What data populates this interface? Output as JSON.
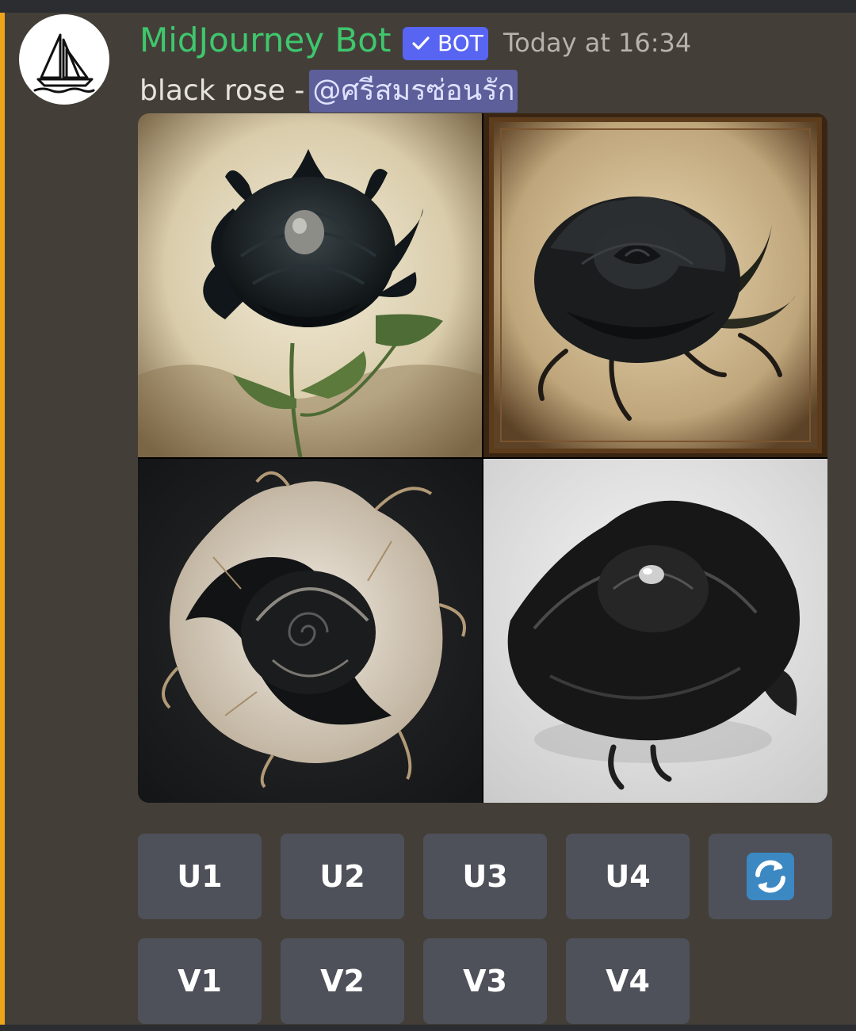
{
  "message": {
    "author": "MidJourney Bot",
    "bot_tag": "BOT",
    "timestamp": "Today at 16:34",
    "prompt": "black rose -",
    "mention": "@ศรีสมรซ่อนรัก",
    "avatar_icon": "sailboat-logo-icon",
    "accent_colors": {
      "username": "#3fc76e",
      "bot_tag": "#5865f2",
      "highlight_bar": "#f0a41a",
      "mention_bg": "#5c5f99"
    }
  },
  "image_grid": {
    "images": [
      {
        "id": 1,
        "icon": "black-rose-on-cream-background"
      },
      {
        "id": 2,
        "icon": "black-rose-framed-parchment"
      },
      {
        "id": 3,
        "icon": "white-black-rose-on-dark-background"
      },
      {
        "id": 4,
        "icon": "black-rose-on-white-background"
      }
    ]
  },
  "buttons": {
    "upscale": [
      "U1",
      "U2",
      "U3",
      "U4"
    ],
    "variation": [
      "V1",
      "V2",
      "V3",
      "V4"
    ],
    "reroll_icon": "reroll-arrows-icon"
  }
}
